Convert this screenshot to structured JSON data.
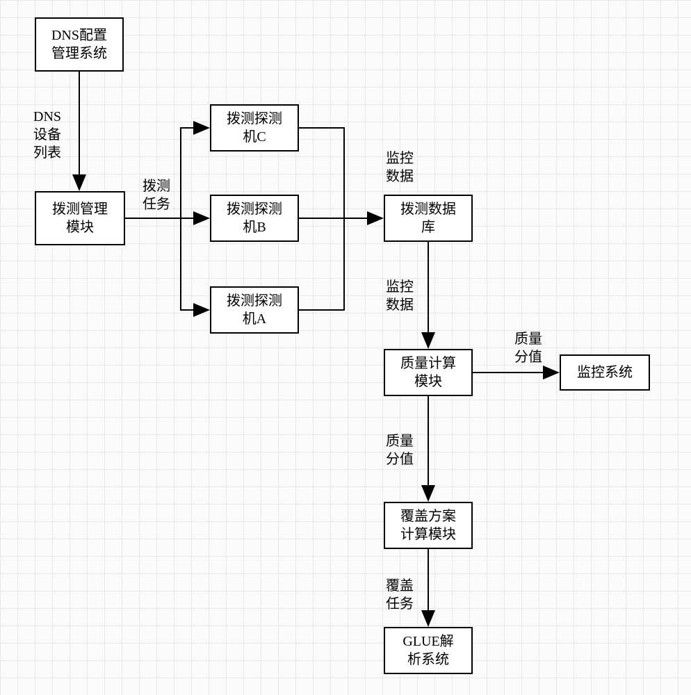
{
  "nodes": {
    "dns_config": "DNS配置\n管理系统",
    "probe_mgr": "拨测管理\n模块",
    "probe_c": "拨测探测\n机C",
    "probe_b": "拨测探测\n机B",
    "probe_a": "拨测探测\n机A",
    "probe_db": "拨测数据\n库",
    "quality_calc": "质量计算\n模块",
    "monitor_sys": "监控系统",
    "coverage_calc": "覆盖方案\n计算模块",
    "glue_parser": "GLUE解\n析系统"
  },
  "edges": {
    "dns_device_list": "DNS\n设备\n列表",
    "probe_task": "拨测\n任务",
    "monitor_data_1": "监控\n数据",
    "monitor_data_2": "监控\n数据",
    "quality_score_1": "质量\n分值",
    "quality_score_2": "质量\n分值",
    "coverage_task": "覆盖\n任务"
  }
}
